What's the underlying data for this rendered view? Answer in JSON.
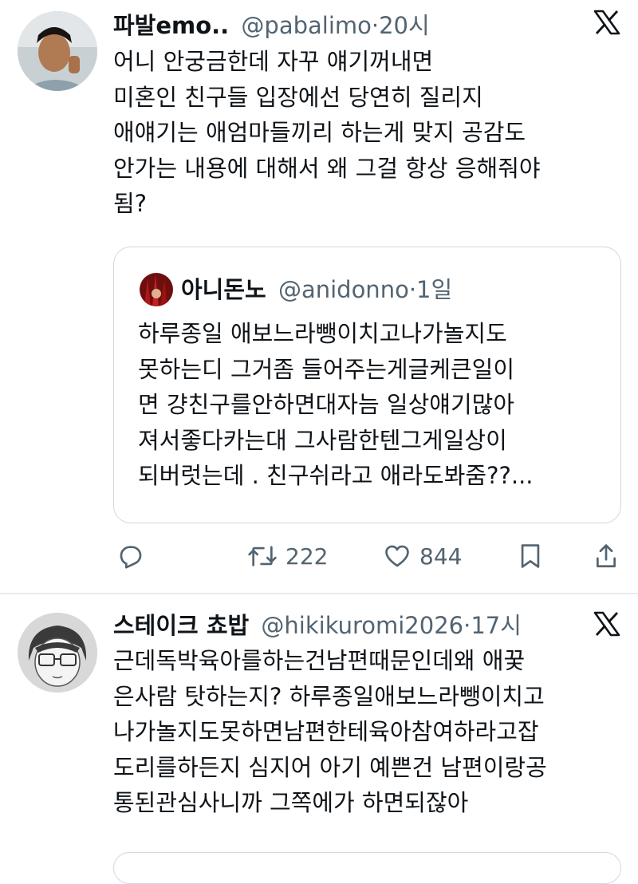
{
  "tweets": [
    {
      "author_name": "파발emo..",
      "handle": "@pabalimo",
      "separator": "·",
      "time": "20시",
      "body_lines": [
        "어니 안궁금한데 자꾸 얘기꺼내면",
        "미혼인 친구들 입장에선 당연히 질리지",
        "애얘기는 애엄마들끼리 하는게 맞지 공감도",
        "안가는 내용에 대해서 왜 그걸 항상 응해줘야",
        "됨?"
      ],
      "quoted": {
        "author_name": "아니돈노",
        "handle": "@anidonno",
        "separator": "·",
        "time": "1일",
        "body_lines": [
          "하루종일 애보느라뺑이치고나가놀지도",
          "못하는디 그거좀 들어주는게글케큰일이",
          "면 걍친구를안하면대자늠 일상얘기많아",
          "져서좋다카는대 그사람한텐그게일상이",
          "되버럿는데 . 친구쉬라고 애라도봐줌??..."
        ]
      },
      "actions": {
        "reply_icon": "reply-icon",
        "retweet_icon": "retweet-icon",
        "retweet_count": "222",
        "like_icon": "heart-icon",
        "like_count": "844",
        "bookmark_icon": "bookmark-icon",
        "share_icon": "share-icon"
      }
    },
    {
      "author_name": "스테이크 쵸밥",
      "handle": "@hikikuromi2026",
      "separator": "·",
      "time": "17시",
      "body_lines": [
        "근데독박육아를하는건남편때문인데왜 애꿎",
        "은사람 탓하는지? 하루종일애보느라뺑이치고",
        "나가놀지도못하면남편한테육아참여하라고잡",
        "도리를하든지 심지어 아기 예쁜건 남편이랑공",
        "통된관심사니까 그쪽에가 하면되잖아"
      ]
    }
  ],
  "platform_icon": "x-logo-icon",
  "colors": {
    "text": "#0f1419",
    "secondary": "#536471",
    "border": "#cfd9de"
  }
}
